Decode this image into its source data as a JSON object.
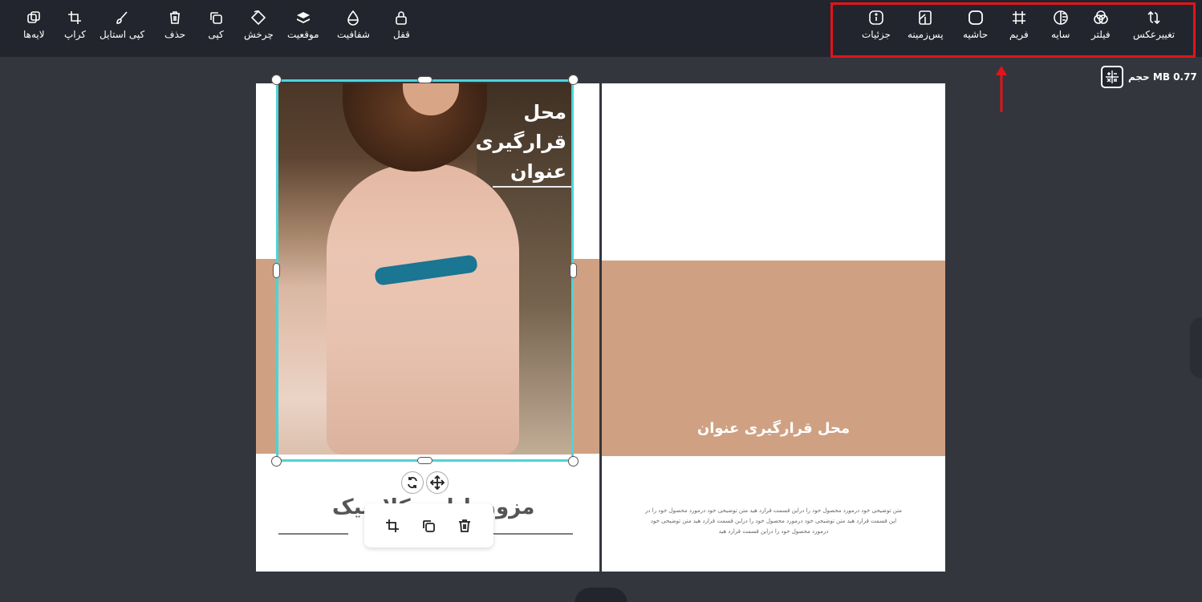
{
  "toolbar_left": [
    {
      "id": "layers",
      "label": "لایه‌ها",
      "icon": "layers-icon"
    },
    {
      "id": "crop",
      "label": "کراپ",
      "icon": "crop-icon"
    },
    {
      "id": "copy_style",
      "label": "کپی استایل",
      "icon": "brush-icon"
    },
    {
      "id": "delete",
      "label": "حذف",
      "icon": "trash-icon"
    },
    {
      "id": "copy",
      "label": "کپی",
      "icon": "copy-icon"
    },
    {
      "id": "rotate",
      "label": "چرخش",
      "icon": "rotate-icon"
    },
    {
      "id": "position",
      "label": "موقعیت",
      "icon": "stack-icon"
    },
    {
      "id": "opacity",
      "label": "شفافیت",
      "icon": "drop-icon"
    },
    {
      "id": "lock",
      "label": "قفل",
      "icon": "lock-icon"
    }
  ],
  "toolbar_right": [
    {
      "id": "details",
      "label": "جزئیات",
      "icon": "info-icon"
    },
    {
      "id": "background",
      "label": "پس‌زمینه",
      "icon": "background-icon"
    },
    {
      "id": "border",
      "label": "حاشیه",
      "icon": "border-icon"
    },
    {
      "id": "frame",
      "label": "فریم",
      "icon": "frame-icon"
    },
    {
      "id": "shadow",
      "label": "سایه",
      "icon": "shadow-icon"
    },
    {
      "id": "filter",
      "label": "فیلتر",
      "icon": "filter-icon"
    },
    {
      "id": "replace",
      "label": "تغییرعکس",
      "icon": "replace-icon"
    }
  ],
  "size_info": "حجم MB 0.77",
  "left_page": {
    "photo_title": "محل قرارگیری عنوان",
    "heading": "مزون لباس کلاسیک"
  },
  "right_page": {
    "title": "محل قرارگیری عنوان",
    "body": "متن توضیحی خود درمورد محصول خود را دراین قسمت قرارد هید متن توضیحی خود درمورد محصول خود را در این قسمت قرارد هید متن توضیحی خود درمورد محصول خود را دراین قسمت قرارد هید متن توضیحی خود درمورد محصول خود را دراین قسمت قرارد هید"
  },
  "colors": {
    "accent": "#4fd3d6",
    "highlight": "#e3141a",
    "band": "#cfa182",
    "toolbar_bg": "#22252d",
    "canvas_bg": "#33363d"
  }
}
